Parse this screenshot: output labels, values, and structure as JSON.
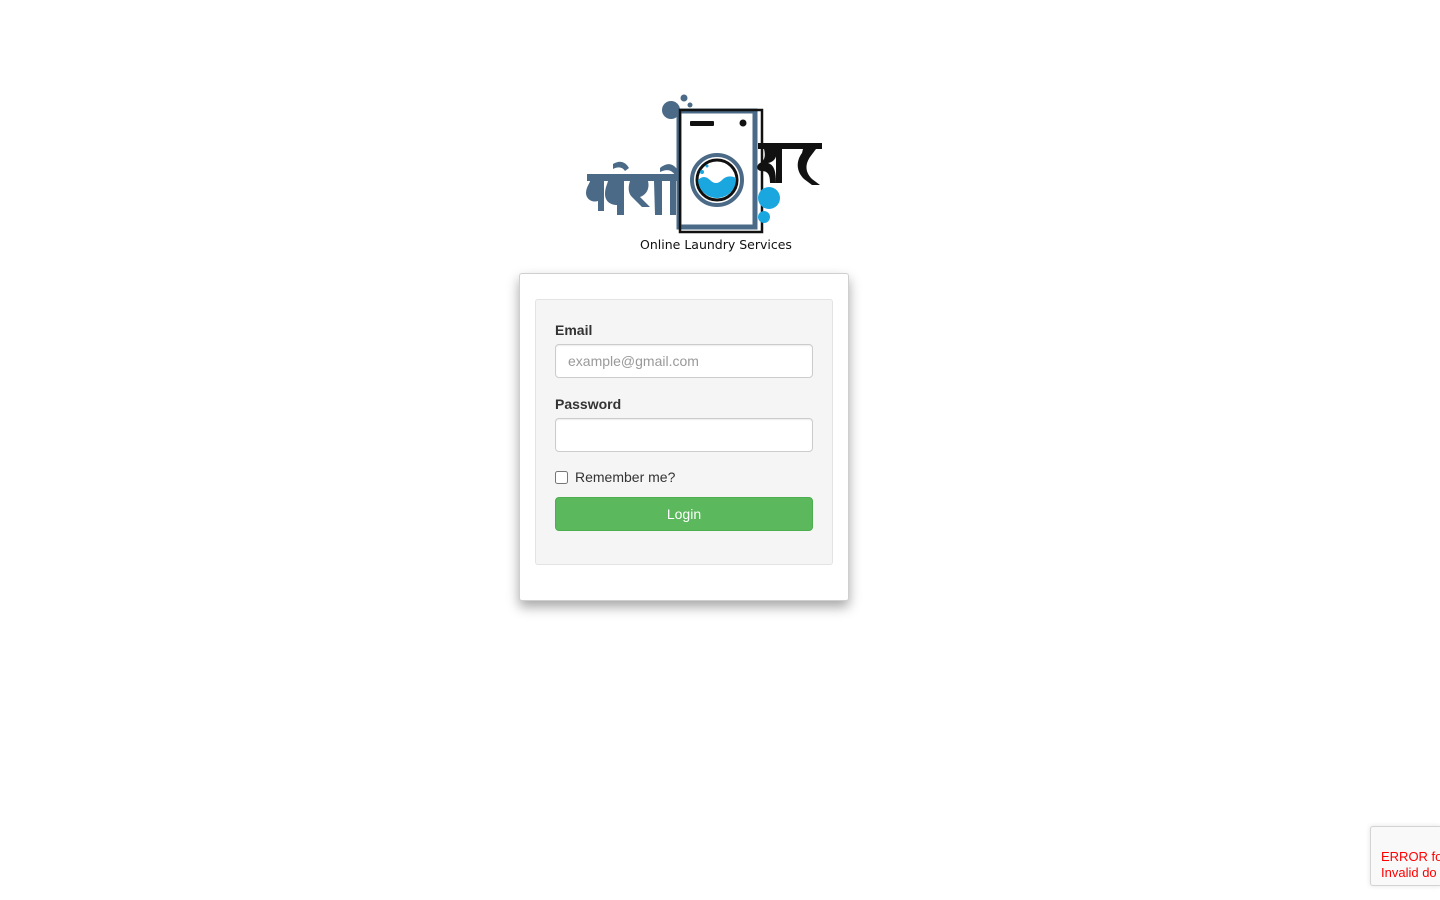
{
  "logo": {
    "brand_text": "धोबी घर",
    "tagline": "Online Laundry Services",
    "colors": {
      "slate": "#4b6a87",
      "blue": "#1aa7e0",
      "black": "#111111"
    }
  },
  "login_form": {
    "email_label": "Email",
    "email_placeholder": "example@gmail.com",
    "email_value": "",
    "password_label": "Password",
    "password_value": "",
    "remember_label": "Remember me?",
    "remember_checked": false,
    "login_button": "Login"
  },
  "recaptcha": {
    "error_line1": "ERROR fo",
    "error_line2": "Invalid do"
  },
  "colors": {
    "button_green": "#5cb85c",
    "error_red": "#ff0000"
  }
}
